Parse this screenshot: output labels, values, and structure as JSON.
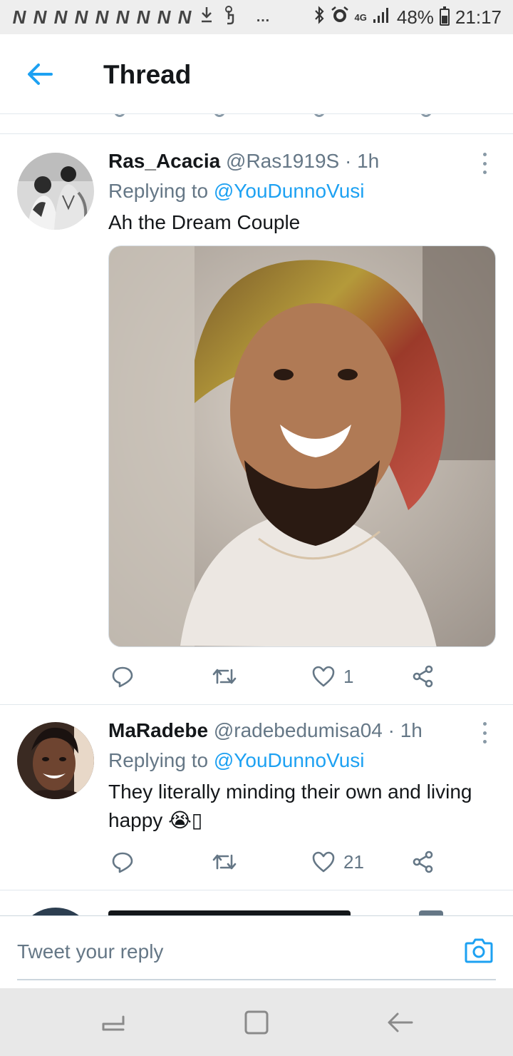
{
  "status_bar": {
    "notification_letters": [
      "N",
      "N",
      "N",
      "N",
      "N",
      "N",
      "N",
      "N",
      "N"
    ],
    "download_icon": "download-icon",
    "touch_icon": "touch-icon",
    "more_dots": "…",
    "network_label": "4G",
    "battery": "48%",
    "time": "21:17"
  },
  "header": {
    "title": "Thread",
    "back_icon": "arrow-left-icon"
  },
  "tweets": [
    {
      "name": "Ras_Acacia",
      "handle": "@Ras1919S",
      "separator": "·",
      "time": "1h",
      "replying_prefix": "Replying to ",
      "replying_to": "@YouDunnoVusi",
      "text": "Ah the Dream Couple",
      "has_media": true,
      "actions": {
        "reply_count": "",
        "retweet_count": "",
        "like_count": "1"
      }
    },
    {
      "name": "MaRadebe",
      "handle": "@radebedumisa04",
      "separator": "·",
      "time": "1h",
      "replying_prefix": "Replying to ",
      "replying_to": "@YouDunnoVusi",
      "text": "They literally minding their own and living happy 😭▯",
      "has_media": false,
      "actions": {
        "reply_count": "",
        "retweet_count": "",
        "like_count": "21"
      }
    }
  ],
  "composer": {
    "placeholder": "Tweet your reply",
    "camera_icon": "camera-icon"
  },
  "colors": {
    "accent": "#1da1f2",
    "muted": "#657786",
    "text": "#14171a",
    "divider": "#e1e8ed"
  }
}
